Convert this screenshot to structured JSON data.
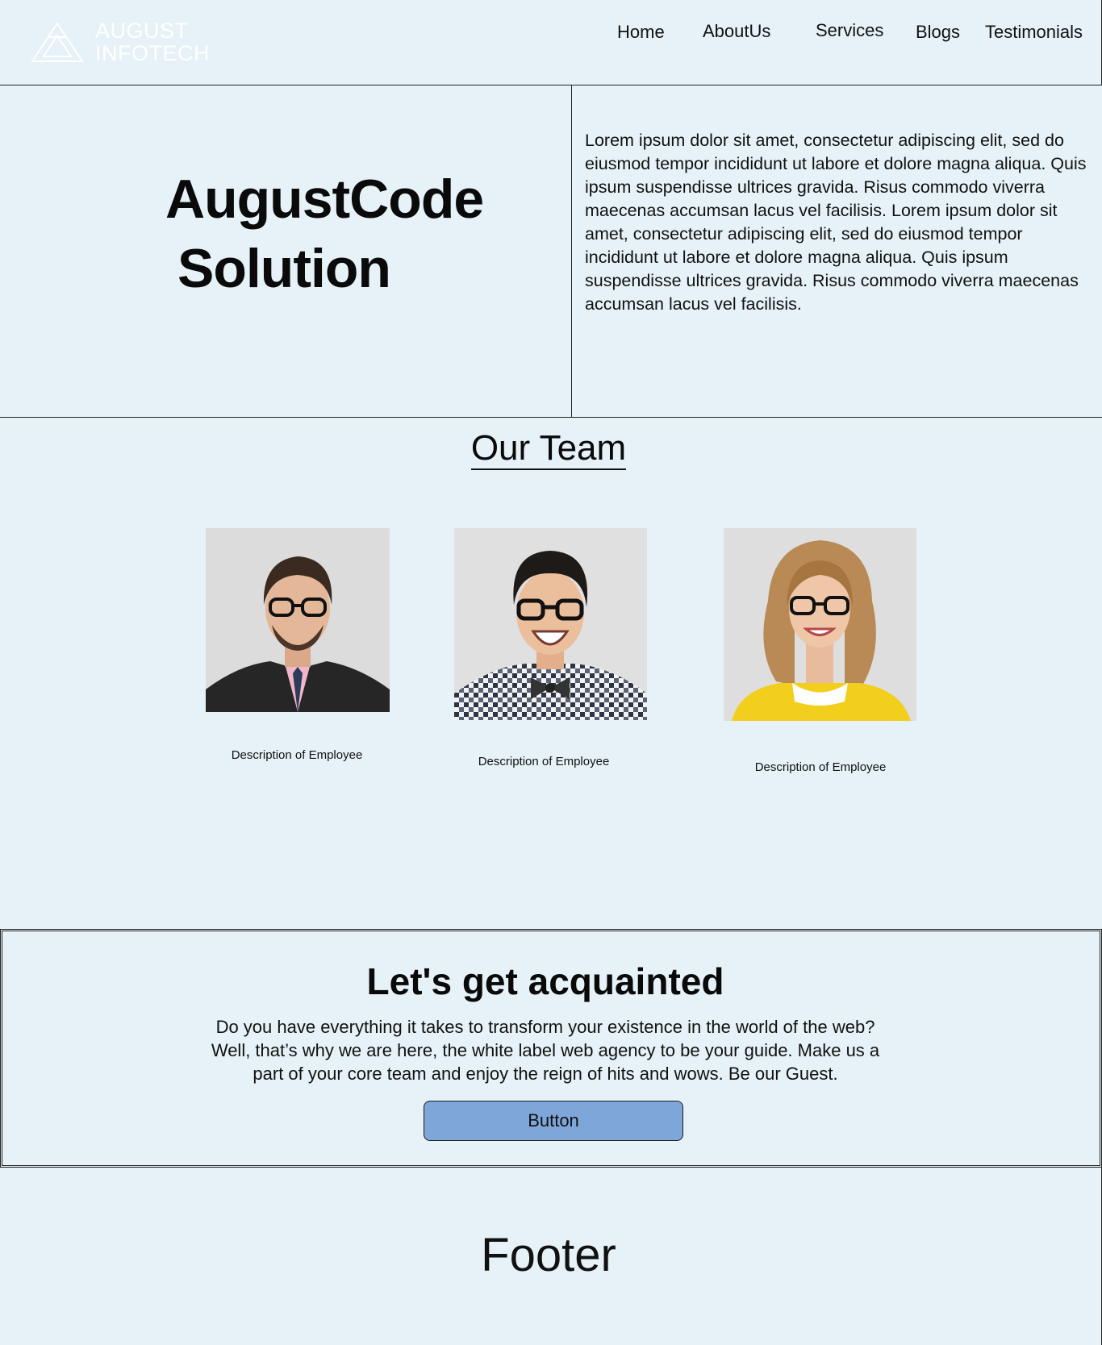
{
  "brand": {
    "logo_line1": "AUGUST",
    "logo_line2": "INFOTECH"
  },
  "nav": {
    "items": [
      {
        "label": "Home"
      },
      {
        "label": "AboutUs"
      },
      {
        "label": "Services"
      },
      {
        "label": "Blogs"
      },
      {
        "label": "Testimonials"
      }
    ]
  },
  "hero": {
    "title_line1": "AugustCode",
    "title_line2": "Solution",
    "body": "Lorem ipsum dolor sit amet, consectetur adipiscing elit, sed do eiusmod tempor incididunt ut labore et dolore magna aliqua. Quis ipsum suspendisse ultrices gravida. Risus commodo viverra maecenas accumsan lacus vel facilisis. Lorem ipsum dolor sit amet, consectetur adipiscing elit, sed do eiusmod tempor incididunt ut labore et dolore magna aliqua. Quis ipsum suspendisse ultrices gravida. Risus commodo viverra maecenas accumsan lacus vel facilisis."
  },
  "team": {
    "heading": "Our Team",
    "members": [
      {
        "description": "Description of Employee"
      },
      {
        "description": "Description of Employee"
      },
      {
        "description": "Description of Employee"
      }
    ]
  },
  "cta": {
    "heading": "Let's get acquainted",
    "body": "Do you have everything it takes to transform your existence in the world of the web? Well, that’s why we are here, the white label web agency to be your guide. Make us a part of your core team and enjoy the reign of hits and wows. Be our Guest.",
    "button_label": "Button"
  },
  "footer": {
    "label": "Footer"
  },
  "colors": {
    "background": "#e6f2f8",
    "button": "#7ea6d8",
    "text": "#0a0a0a"
  }
}
